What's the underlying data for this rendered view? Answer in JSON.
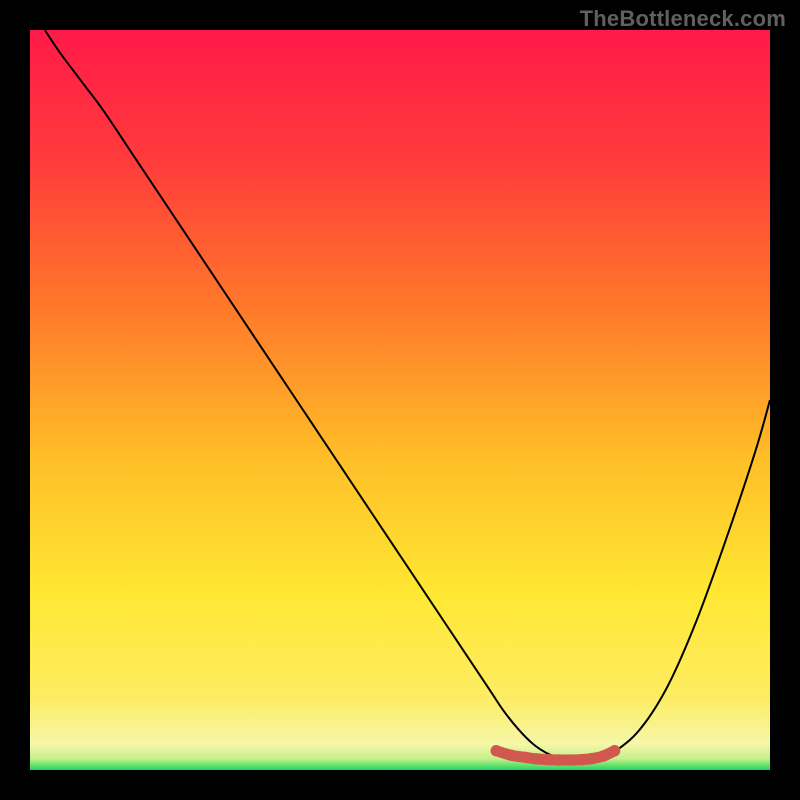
{
  "watermark": "TheBottleneck.com",
  "colors": {
    "frame": "#000000",
    "curve": "#000000",
    "marker": "#d1574f",
    "gradient_stops": [
      {
        "offset": 0.0,
        "color": "#ff1a49"
      },
      {
        "offset": 0.18,
        "color": "#ff3c3a"
      },
      {
        "offset": 0.38,
        "color": "#ff7a2a"
      },
      {
        "offset": 0.58,
        "color": "#ffbf28"
      },
      {
        "offset": 0.76,
        "color": "#ffe733"
      },
      {
        "offset": 0.9,
        "color": "#fdec61"
      },
      {
        "offset": 0.965,
        "color": "#f6f7a8"
      },
      {
        "offset": 0.985,
        "color": "#c5f08a"
      },
      {
        "offset": 1.0,
        "color": "#1fd65b"
      }
    ]
  },
  "chart_data": {
    "type": "line",
    "title": "",
    "xlabel": "",
    "ylabel": "",
    "xlim": [
      0,
      100
    ],
    "ylim": [
      0,
      100
    ],
    "grid": false,
    "legend": false,
    "series": [
      {
        "name": "bottleneck-curve",
        "x": [
          2,
          4,
          7,
          10,
          14,
          18,
          22,
          26,
          30,
          34,
          38,
          42,
          46,
          50,
          54,
          58,
          62,
          64,
          66,
          68,
          70,
          72,
          74,
          76,
          78,
          82,
          86,
          90,
          94,
          98,
          100
        ],
        "y": [
          100,
          97,
          93,
          89,
          83,
          77,
          71,
          65,
          59,
          53,
          47,
          41,
          35,
          29,
          23,
          17,
          11,
          8,
          5.5,
          3.5,
          2.2,
          1.5,
          1.2,
          1.3,
          1.9,
          5,
          11,
          20,
          31,
          43,
          50
        ]
      }
    ],
    "markers": {
      "name": "bottom-cluster",
      "x": [
        63,
        65,
        67,
        68.5,
        70,
        71.5,
        73,
        74.5,
        76,
        77.5,
        79
      ],
      "y": [
        2.6,
        2.0,
        1.7,
        1.5,
        1.4,
        1.35,
        1.35,
        1.4,
        1.55,
        1.9,
        2.6
      ]
    }
  }
}
